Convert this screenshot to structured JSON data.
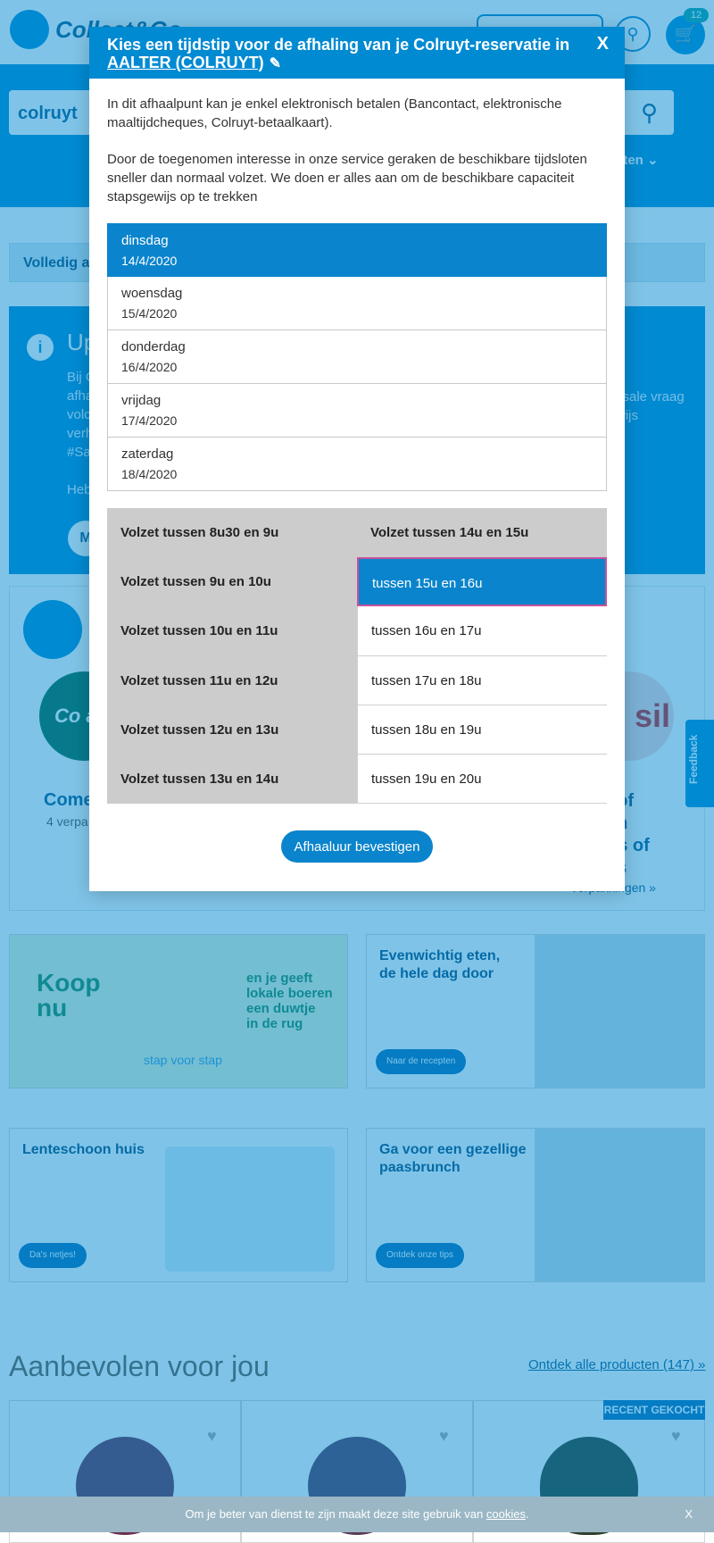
{
  "background": {
    "logo_text": "Collect&Go",
    "cart_count": "12",
    "search_brand": "colruyt",
    "nav_right_label": "eten",
    "filter_label": "Volledig a",
    "info": {
      "title": "Up",
      "lines": [
        "Bij C",
        "afha",
        "volc",
        "verh",
        "#Sa",
        "",
        "Heb"
      ],
      "right_lines": [
        "ssale vraag",
        "wijs"
      ],
      "pill": "M"
    },
    "promo": {
      "left_brand": "Co a c",
      "left_name": "Come",
      "left_sub": "4 verpa",
      "right_brand": "an sil",
      "right_name": [
        "l of",
        "an",
        "ps of",
        "cs"
      ],
      "right_sub": "verpakkingen »"
    },
    "feedback_label": "Feedback",
    "banners": {
      "green": {
        "big": [
          "Koop",
          "nu"
        ],
        "text": [
          "en je geeft",
          "lokale boeren",
          "een duwtje",
          "in de rug"
        ],
        "footer": "stap voor stap"
      },
      "food": {
        "title": [
          "Evenwichtig eten,",
          "de hele dag door"
        ],
        "button": "Naar de recepten"
      },
      "clean": {
        "title": "Lenteschoon huis",
        "button": "Da's netjes!"
      },
      "easter": {
        "title": [
          "Ga voor een gezellige",
          "paasbrunch"
        ],
        "button": "Ontdek onze tips"
      }
    },
    "recommended": {
      "title": "Aanbevolen voor jou",
      "link": "Ontdek alle producten (147) »",
      "recent_badge": "RECENT GEKOCHT"
    },
    "cookie": {
      "text": "Om je beter van dienst te zijn maakt deze site gebruik van",
      "link": "cookies",
      "suffix": ".",
      "close": "X"
    }
  },
  "modal": {
    "title_prefix": "Kies een tijdstip voor de afhaling van je Colruyt-reservatie in",
    "store": "AALTER (COLRUYT)",
    "close": "X",
    "paragraph_1": "In dit afhaalpunt kan je enkel elektronisch betalen (Bancontact, elektronische maaltijdcheques, Colruyt-betaalkaart).",
    "paragraph_2": "Door de toegenomen interesse in onze service geraken de beschikbare tijdsloten sneller dan normaal volzet. We doen er alles aan om de beschikbare capaciteit stapsgewijs op te trekken",
    "days": [
      {
        "name": "dinsdag",
        "date": "14/4/2020",
        "selected": true
      },
      {
        "name": "woensdag",
        "date": "15/4/2020",
        "selected": false
      },
      {
        "name": "donderdag",
        "date": "16/4/2020",
        "selected": false
      },
      {
        "name": "vrijdag",
        "date": "17/4/2020",
        "selected": false
      },
      {
        "name": "zaterdag",
        "date": "18/4/2020",
        "selected": false
      }
    ],
    "slots_left": [
      "Volzet tussen 8u30 en 9u",
      "Volzet tussen 9u en 10u",
      "Volzet tussen 10u en 11u",
      "Volzet tussen 11u en 12u",
      "Volzet tussen 12u en 13u",
      "Volzet tussen 13u en 14u"
    ],
    "slots_right": [
      "Volzet tussen 14u en 15u",
      "tussen 15u en 16u",
      "tussen 16u en 17u",
      "tussen 17u en 18u",
      "tussen 18u en 19u",
      "tussen 19u en 20u"
    ],
    "confirm_button": "Afhaaluur bevestigen"
  },
  "colors": {
    "brand_blue": "#008ad2",
    "selected_blue": "#0a84cc",
    "full_slot_grey": "#cccccc",
    "focus_outline": "#c8529b"
  }
}
